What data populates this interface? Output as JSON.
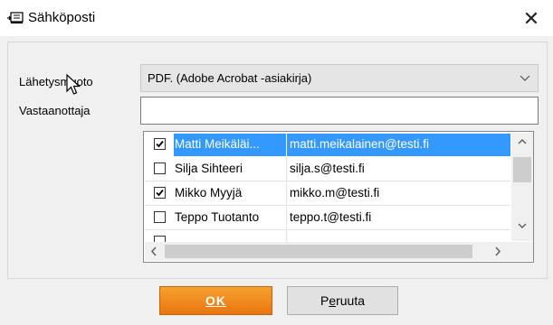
{
  "window": {
    "title": "Sähköposti",
    "icon": "email-window-icon",
    "close_glyph": "✕"
  },
  "form": {
    "format_label": "Lähetysmuoto",
    "format_value": "PDF. (Adobe Acrobat -asiakirja)",
    "recipient_label": "Vastaanottaja",
    "recipient_value": ""
  },
  "contacts": [
    {
      "name": "Matti Meikäläi...",
      "email": "matti.meikalainen@testi.fi",
      "checked": true,
      "selected": true
    },
    {
      "name": "Silja Sihteeri",
      "email": "silja.s@testi.fi",
      "checked": false,
      "selected": false
    },
    {
      "name": "Mikko Myyjä",
      "email": "mikko.m@testi.fi",
      "checked": true,
      "selected": false
    },
    {
      "name": "Teppo Tuotanto",
      "email": "teppo.t@testi.fi",
      "checked": false,
      "selected": false
    },
    {
      "name": "",
      "email": "",
      "checked": false,
      "selected": false
    }
  ],
  "buttons": {
    "ok_label": "OK",
    "ok_mnemonic": "O",
    "cancel_label": "Peruuta",
    "cancel_mnemonic": "e"
  },
  "colors": {
    "accent": "#3399ff",
    "ok_button": "#f08a1e",
    "dialog_bg": "#f0f0f0"
  }
}
